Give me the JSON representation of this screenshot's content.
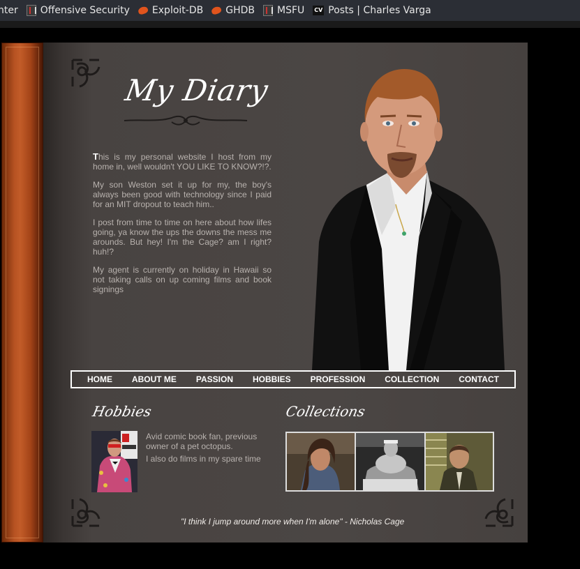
{
  "bookmarks": [
    {
      "label": "nter",
      "icon": "none"
    },
    {
      "label": "Offensive Security",
      "icon": "offensive-security-icon"
    },
    {
      "label": "Exploit-DB",
      "icon": "exploit-db-icon"
    },
    {
      "label": "GHDB",
      "icon": "exploit-db-icon"
    },
    {
      "label": "MSFU",
      "icon": "offensive-security-icon"
    },
    {
      "label": "Posts | Charles Varga",
      "icon": "cv-icon"
    }
  ],
  "cv_icon_text": "CV",
  "site": {
    "title": "My Diary",
    "intro": {
      "dropcap": "T",
      "p1_rest": "his is my personal website I host from my home in, well wouldn't YOU LIKE TO KNOW?!?.",
      "p2": "My son Weston set it up for my, the boy's always been good with technology since I paid for an MIT dropout to teach him..",
      "p3": "I post from time to time on here about how lifes going, ya know the ups the downs the mess me arounds. But hey! I'm the Cage? am I right? huh!?",
      "p4": "My agent is currently on holiday in Hawaii so not taking calls on up coming films and book signings"
    },
    "nav": [
      "HOME",
      "ABOUT ME",
      "PASSION",
      "HOBBIES",
      "PROFESSION",
      "COLLECTION",
      "CONTACT"
    ],
    "hobbies": {
      "heading": "Hobbies",
      "line1": "Avid comic book fan, previous owner of a pet octopus.",
      "line2": "I also do films in my spare time"
    },
    "collections": {
      "heading": "Collections"
    },
    "quote": "\"I think I jump around more when I'm alone\" - Nicholas Cage"
  },
  "colors": {
    "page": "#4b4644",
    "spine": "#b65222",
    "body_text": "#b8b2ae",
    "accent_white": "#ffffff"
  }
}
